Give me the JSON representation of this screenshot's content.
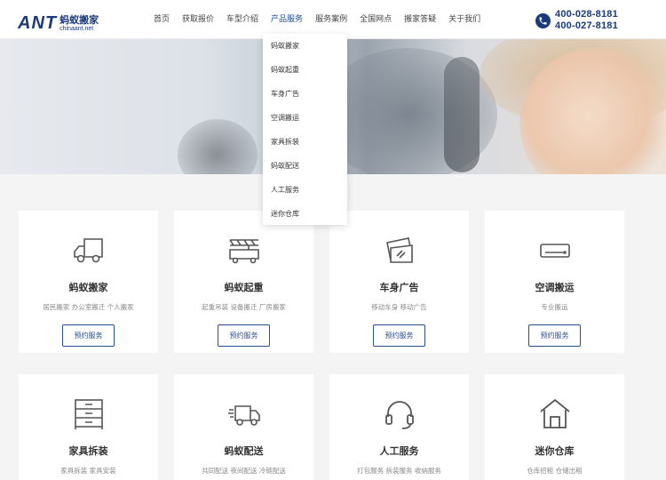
{
  "header": {
    "logo_mark": "ANT",
    "logo_cn": "蚂蚁搬家",
    "logo_en": "chinaant.net",
    "nav": [
      "首页",
      "获取报价",
      "车型介绍",
      "产品服务",
      "服务案例",
      "全国网点",
      "搬家答疑",
      "关于我们"
    ],
    "active_nav": "产品服务",
    "phones": [
      "400-028-8181",
      "400-027-8181"
    ]
  },
  "dropdown": {
    "items": [
      "蚂蚁搬家",
      "蚂蚁起重",
      "车身广告",
      "空调搬运",
      "家具拆装",
      "蚂蚁配送",
      "人工服务",
      "迷你仓库"
    ]
  },
  "services": [
    {
      "title": "蚂蚁搬家",
      "sub": "居民搬家 办公室搬迁 个人搬家",
      "button": "预约服务",
      "icon": "truck-icon"
    },
    {
      "title": "蚂蚁起重",
      "sub": "起重吊装 设备搬迁 厂房搬家",
      "button": "预约服务",
      "icon": "crane-icon"
    },
    {
      "title": "车身广告",
      "sub": "移动车身 移动广告",
      "button": "预约服务",
      "icon": "card-ad-icon"
    },
    {
      "title": "空调搬运",
      "sub": "专业搬运",
      "button": "预约服务",
      "icon": "air-conditioner-icon"
    },
    {
      "title": "家具拆装",
      "sub": "家具拆装 家具安装",
      "button": "",
      "icon": "cabinet-icon"
    },
    {
      "title": "蚂蚁配送",
      "sub": "共同配送 夜间配送 冷链配送",
      "button": "",
      "icon": "delivery-truck-icon"
    },
    {
      "title": "人工服务",
      "sub": "打包服务 拆装服务 收纳服务",
      "button": "",
      "icon": "headset-icon"
    },
    {
      "title": "迷你仓库",
      "sub": "仓库招租 仓储出租",
      "button": "",
      "icon": "warehouse-icon"
    }
  ],
  "colors": {
    "brand": "#1a3a7c",
    "accent": "#2a4d8f",
    "background": "#f4f4f4"
  }
}
